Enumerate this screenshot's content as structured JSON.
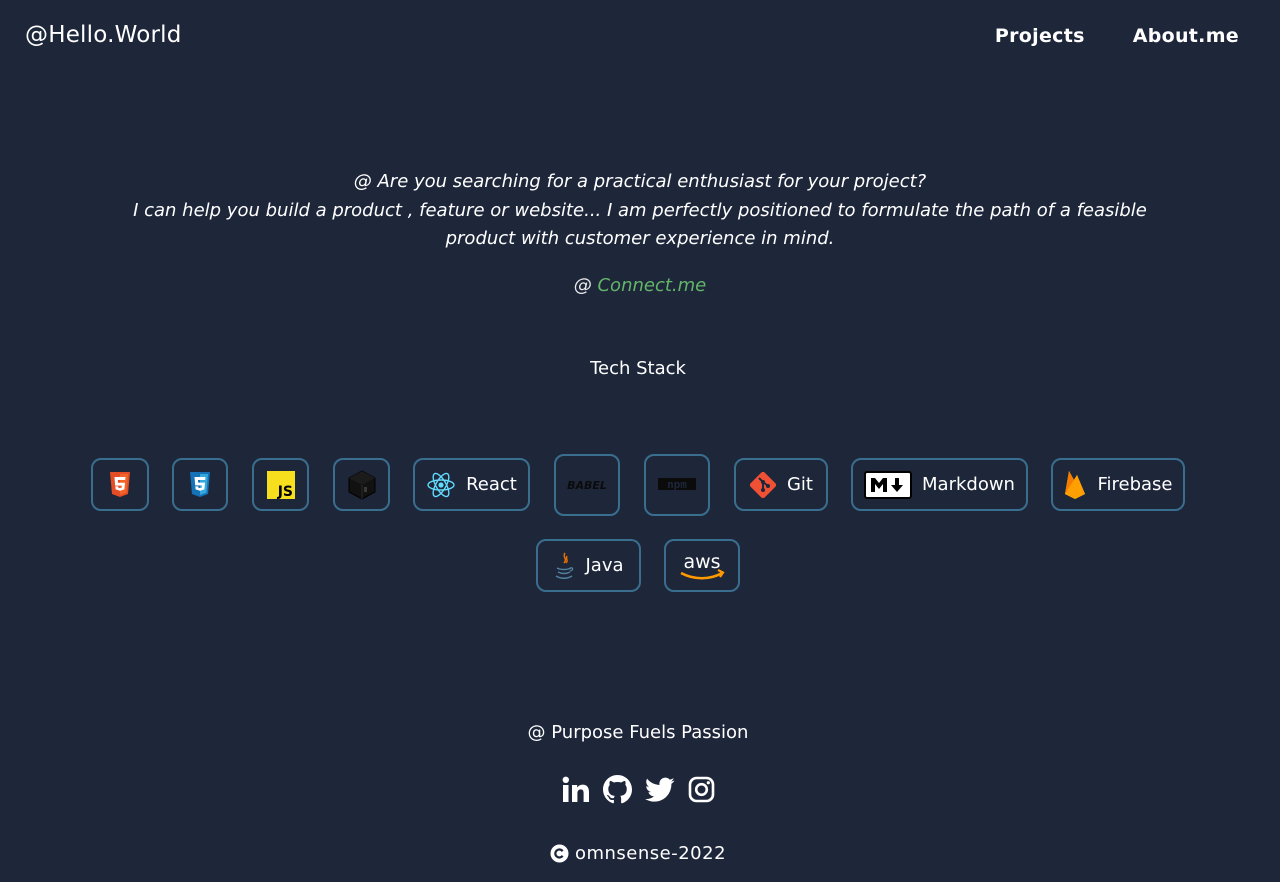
{
  "header": {
    "brand": "@Hello.World",
    "nav": [
      {
        "label": "Projects"
      },
      {
        "label": "About.me"
      }
    ]
  },
  "intro": {
    "line1": "@ Are you searching for a practical enthusiast for your project?",
    "line2": "I can help you build a product , feature or website... I am perfectly positioned to formulate the path of a feasible",
    "line3": "product with customer experience in mind.",
    "connect_prefix": "@ ",
    "connect_label": "Connect.me",
    "connect_color": "#63b568"
  },
  "tech_stack": {
    "title": "Tech Stack",
    "items": [
      {
        "icon": "html5-icon",
        "label": ""
      },
      {
        "icon": "css3-icon",
        "label": ""
      },
      {
        "icon": "javascript-icon",
        "label": "JS"
      },
      {
        "icon": "cube-icon",
        "label": ""
      },
      {
        "icon": "react-icon",
        "label": "React"
      },
      {
        "icon": "babel-icon",
        "label": "BABEL"
      },
      {
        "icon": "npm-icon",
        "label": "npm"
      },
      {
        "icon": "git-icon",
        "label": "Git"
      },
      {
        "icon": "markdown-icon",
        "label": "Markdown"
      },
      {
        "icon": "firebase-icon",
        "label": "Firebase"
      },
      {
        "icon": "java-icon",
        "label": "Java"
      },
      {
        "icon": "aws-icon",
        "label": "aws"
      }
    ]
  },
  "footer": {
    "tagline": "@ Purpose Fuels Passion",
    "socials": [
      "linkedin-icon",
      "github-icon",
      "twitter-icon",
      "instagram-icon"
    ],
    "copyright": "omnsense-2022"
  },
  "colors": {
    "background": "#1e263a",
    "chip_border": "#3a6e8e",
    "link_green": "#63b568"
  }
}
